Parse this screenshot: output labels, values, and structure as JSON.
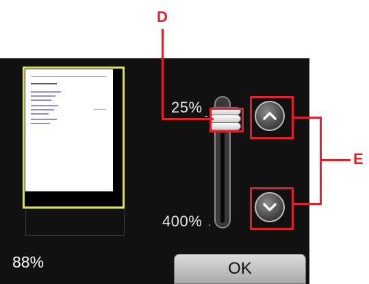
{
  "preview": {
    "document_lines": [
      "heading",
      "body",
      "body",
      "body",
      "body",
      "body",
      "body",
      "body",
      "body",
      "signature"
    ]
  },
  "scale": {
    "min_label": "25%",
    "max_label": "400%"
  },
  "zoom": {
    "current_value": "88%"
  },
  "buttons": {
    "ok_label": "OK",
    "increase_icon": "chevron-up-icon",
    "decrease_icon": "chevron-down-icon"
  },
  "callouts": {
    "d_label": "D",
    "e_label": "E"
  },
  "colors": {
    "callout": "#e0202a",
    "preview_border": "#e8e82a",
    "panel_background": "#111111"
  }
}
